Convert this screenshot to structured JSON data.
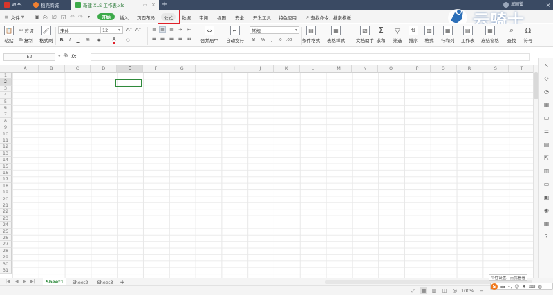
{
  "titlebar": {
    "tabs": [
      {
        "label": "WPS"
      },
      {
        "label": "稻壳商城"
      },
      {
        "label": "新建 XLS 工作表.xls"
      }
    ],
    "new_tab": "+",
    "user": "城固镇"
  },
  "menu": {
    "file": "文件",
    "tabs": [
      "开始",
      "插入",
      "页面布局",
      "公式",
      "数据",
      "审阅",
      "视图",
      "安全",
      "开发工具",
      "特色应用"
    ],
    "search": "查找命令、搜索模板"
  },
  "watermark": {
    "text": "云骑士"
  },
  "ribbon": {
    "paste": "粘贴",
    "cut": "剪切",
    "copy": "复制",
    "format_painter": "格式刷",
    "font_name": "宋体",
    "font_size": "12",
    "merge_center": "合并居中",
    "wrap_text": "自动换行",
    "number_format": "常规",
    "cond_format": "条件格式",
    "table_style": "表格样式",
    "doc_assistant": "文档助手",
    "sum": "求和",
    "filter": "筛选",
    "sort": "排序",
    "format": "格式",
    "row_col": "行和列",
    "worksheet": "工作表",
    "freeze": "冻结窗格",
    "find": "查找",
    "symbol": "符号"
  },
  "formula_bar": {
    "name_box": "E2",
    "fx": "fx",
    "value": ""
  },
  "grid": {
    "columns": [
      "A",
      "B",
      "C",
      "D",
      "E",
      "F",
      "G",
      "H",
      "I",
      "J",
      "K",
      "L",
      "M",
      "N",
      "O",
      "P",
      "Q",
      "R",
      "S",
      "T"
    ],
    "rows": [
      "1",
      "2",
      "3",
      "4",
      "5",
      "6",
      "7",
      "8",
      "9",
      "10",
      "11",
      "12",
      "13",
      "14",
      "15",
      "16",
      "17",
      "18",
      "19",
      "20",
      "21",
      "22",
      "23",
      "24",
      "25",
      "26",
      "27",
      "28",
      "29",
      "30",
      "31"
    ],
    "selected_cell": "E2"
  },
  "sheets": [
    "Sheet1",
    "Sheet2",
    "Sheet3"
  ],
  "status": {
    "zoom": "100%",
    "tooltip": "个性设置、点我看看",
    "ime_lang": "中"
  },
  "colors": {
    "accent": "#3daa4a",
    "highlight_box": "#e0202a",
    "titlebar": "#3a4a63"
  }
}
